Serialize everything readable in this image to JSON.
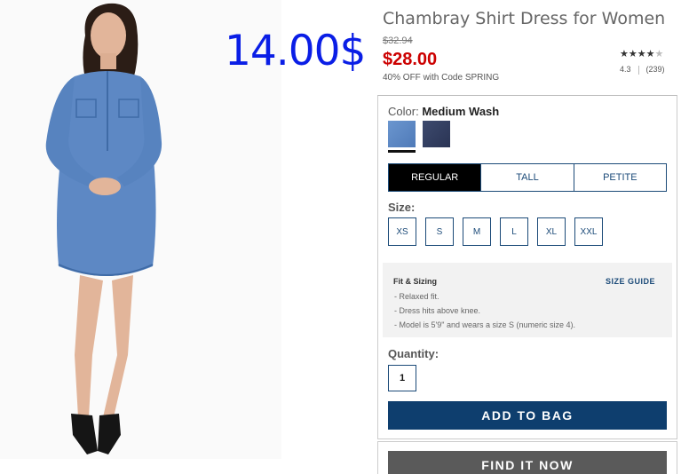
{
  "overlay_price": "14.00$",
  "product": {
    "title": "Chambray Shirt Dress for Women",
    "old_price": "$32.94",
    "price": "$28.00",
    "promo": "40% OFF with Code SPRING",
    "stars_filled": "★★★★",
    "stars_empty": "★",
    "rating_value": 4.3,
    "rating": "4.3",
    "review_count": "(239)"
  },
  "color": {
    "label": "Color:",
    "selected": "Medium Wash",
    "swatches": [
      {
        "name": "Medium Wash",
        "color": "#5d88c4"
      },
      {
        "name": "Dark Wash",
        "color": "#34405f"
      }
    ]
  },
  "fit_tabs": [
    {
      "label": "REGULAR",
      "active": true
    },
    {
      "label": "TALL",
      "active": false
    },
    {
      "label": "PETITE",
      "active": false
    }
  ],
  "size": {
    "label": "Size:",
    "options": [
      "XS",
      "S",
      "M",
      "L",
      "XL",
      "XXL"
    ]
  },
  "fit_sizing": {
    "title": "Fit & Sizing",
    "guide_label": "SIZE GUIDE",
    "items": [
      "Relaxed fit.",
      "Dress hits above knee.",
      "Model is 5'9\" and wears a size S (numeric size 4)."
    ]
  },
  "quantity": {
    "label": "Quantity:",
    "value": "1"
  },
  "buttons": {
    "add_to_bag": "ADD TO BAG",
    "find_it_now": "FIND IT NOW"
  },
  "colors": {
    "accent": "#0e3e6e",
    "sale": "#cc0000",
    "overlay": "#0a1ee6"
  }
}
